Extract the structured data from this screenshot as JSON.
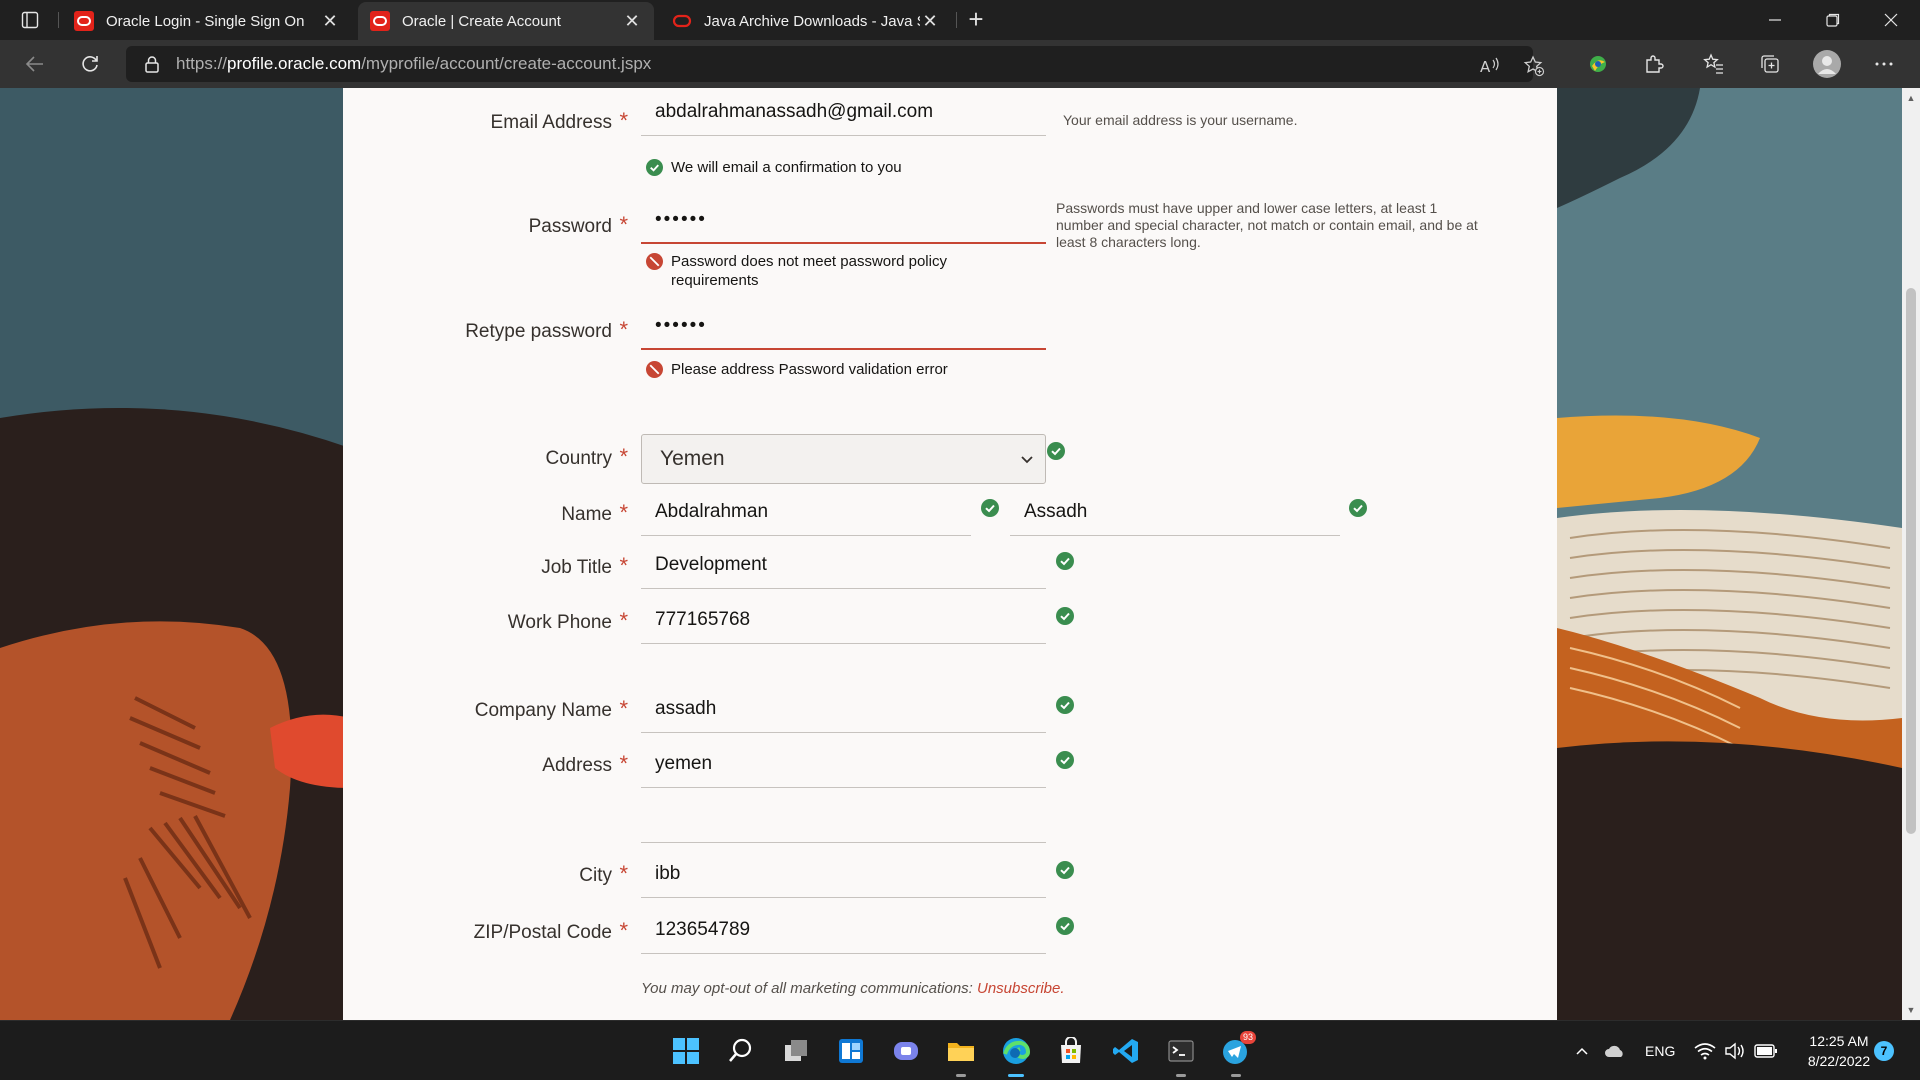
{
  "browser": {
    "tabs": [
      {
        "title": "Oracle Login - Single Sign On",
        "active": false,
        "icon": "oracle-icon"
      },
      {
        "title": "Oracle | Create Account",
        "active": true,
        "icon": "oracle-icon"
      },
      {
        "title": "Java Archive Downloads - Java SE",
        "active": false,
        "icon": "oracle-outline-icon"
      }
    ],
    "url_prefix": "https://",
    "url_host": "profile.oracle.com",
    "url_path": "/myprofile/account/create-account.jspx"
  },
  "form": {
    "email": {
      "label": "Email Address",
      "value": "abdalrahmanassadh@gmail.com",
      "message": "We will email a confirmation to you",
      "hint": "Your email address is your username."
    },
    "password": {
      "label": "Password",
      "value": "••••••",
      "error": "Password does not meet password policy requirements",
      "hint": "Passwords must have upper and lower case letters, at least 1 number and special character, not match or contain email, and be at least 8 characters long."
    },
    "retype": {
      "label": "Retype password",
      "value": "••••••",
      "error": "Please address Password validation error"
    },
    "country": {
      "label": "Country",
      "value": "Yemen"
    },
    "name": {
      "label": "Name",
      "first": "Abdalrahman",
      "last": "Assadh"
    },
    "job_title": {
      "label": "Job Title",
      "value": "Development"
    },
    "work_phone": {
      "label": "Work Phone",
      "value": "777165768"
    },
    "company": {
      "label": "Company Name",
      "value": "assadh"
    },
    "address": {
      "label": "Address",
      "value": "yemen",
      "value2": ""
    },
    "city": {
      "label": "City",
      "value": "ibb"
    },
    "zip": {
      "label": "ZIP/Postal Code",
      "value": "123654789"
    },
    "optout_text": "You may opt-out of all marketing communications:",
    "unsubscribe_label": "Unsubscribe."
  },
  "taskbar": {
    "apps": [
      "windows-start",
      "search",
      "task-view",
      "widgets",
      "teams-chat",
      "file-explorer",
      "edge",
      "microsoft-store",
      "vscode",
      "terminal",
      "telegram"
    ],
    "telegram_badge": "93",
    "language": "ENG",
    "time": "12:25 AM",
    "date": "8/22/2022",
    "notifications": "7"
  },
  "colors": {
    "oracle_red": "#c74634",
    "success_green": "#3a8d4f",
    "edge_accent": "#4cc2ff"
  }
}
